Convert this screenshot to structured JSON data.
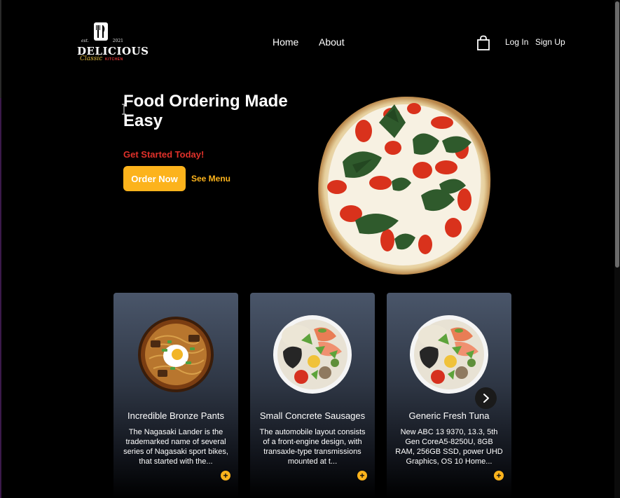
{
  "logo": {
    "est": "est.",
    "year": "2021",
    "title": "DELICIOUS",
    "subtitle": "Classic",
    "subtitle_tag": "KITCHEN"
  },
  "nav": {
    "links": [
      {
        "label": "Home"
      },
      {
        "label": "About"
      }
    ],
    "cart_icon": "shopping-bag-icon",
    "login_label": "Log In",
    "signup_label": "Sign Up"
  },
  "hero": {
    "title": "Food Ordering Made Easy",
    "subtitle": "Get Started Today!",
    "order_button": "Order Now",
    "menu_link": "See Menu"
  },
  "products": [
    {
      "title": "Incredible Bronze Pants",
      "description": "The Nagasaki Lander is the trademarked name of several series of Nagasaki sport bikes, that started with the...",
      "image": "ramen-bowl"
    },
    {
      "title": "Small Concrete Sausages",
      "description": "The automobile layout consists of a front-engine design, with transaxle-type transmissions mounted at t...",
      "image": "salad-bowl"
    },
    {
      "title": "Generic Fresh Tuna",
      "description": "New ABC 13 9370, 13.3, 5th Gen CoreA5-8250U, 8GB RAM, 256GB SSD, power UHD Graphics, OS 10 Home...",
      "image": "salad-bowl"
    }
  ],
  "carousel": {
    "next_icon": "chevron-right-icon",
    "add_icon": "plus-icon"
  },
  "colors": {
    "accent": "#fcb31c",
    "highlight": "#e0312a",
    "background": "#000000"
  }
}
